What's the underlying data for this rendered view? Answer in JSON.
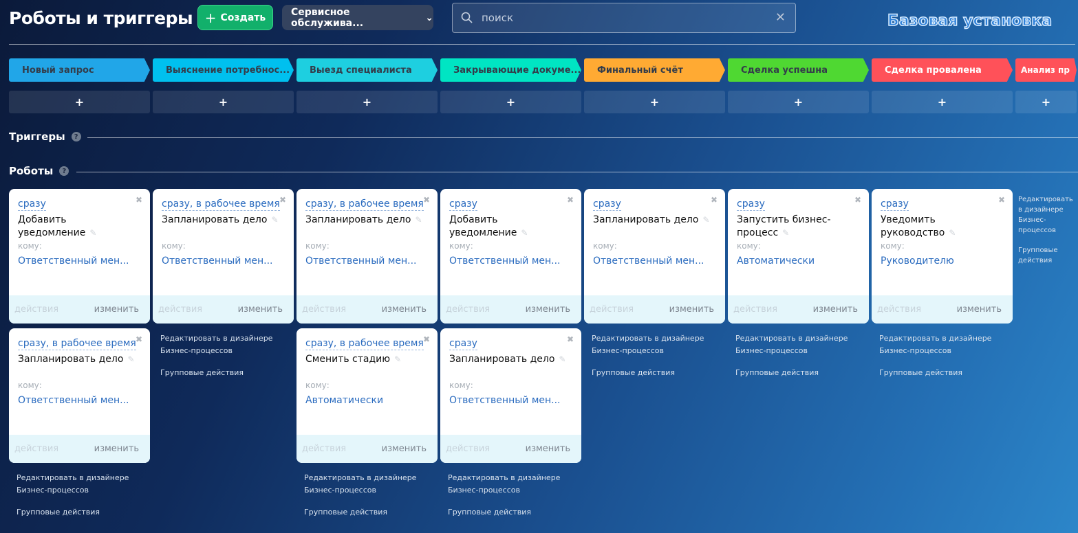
{
  "header": {
    "title": "Роботы и триггеры",
    "create_label": "Создать",
    "category": "Сервисное обслужива...",
    "search_placeholder": "поиск",
    "brand": "Базовая установка"
  },
  "stages": [
    {
      "label": "Новый запрос",
      "color": "#21a6e8",
      "text": "#333c4a"
    },
    {
      "label": "Выяснение потребнос...",
      "color": "#00c0ef",
      "text": "#333c4a"
    },
    {
      "label": "Выезд специалиста",
      "color": "#1ecfe0",
      "text": "#333c4a"
    },
    {
      "label": "Закрывающие докуме...",
      "color": "#00e5c3",
      "text": "#333c4a"
    },
    {
      "label": "Финальный счёт",
      "color": "#ffaa33",
      "text": "#333c4a"
    },
    {
      "label": "Сделка успешна",
      "color": "#4fd832",
      "text": "#333c4a"
    },
    {
      "label": "Сделка провалена",
      "color": "#ff5159",
      "text": "#ffffff"
    },
    {
      "label": "Анализ пр",
      "color": "#ff5159",
      "text": "#ffffff"
    }
  ],
  "add_label": "+",
  "sections": {
    "triggers": "Триггеры",
    "robots": "Роботы",
    "help": "?"
  },
  "card_labels": {
    "to": "кому:",
    "actions": "действия",
    "edit": "изменить"
  },
  "column_links": {
    "designer": "Редактировать в дизайнере Бизнес-процессов",
    "group": "Групповые действия"
  },
  "columns": [
    [
      {
        "when": "сразу",
        "name": "Добавить уведомление",
        "who": "Ответственный мен..."
      },
      {
        "when": "сразу, в рабочее время",
        "name": "Запланировать дело",
        "who": "Ответственный мен..."
      }
    ],
    [
      {
        "when": "сразу, в рабочее время",
        "name": "Запланировать дело",
        "who": "Ответственный мен..."
      }
    ],
    [
      {
        "when": "сразу, в рабочее время",
        "name": "Запланировать дело",
        "who": "Ответственный мен..."
      },
      {
        "when": "сразу, в рабочее время",
        "name": "Сменить стадию",
        "who": "Автоматически"
      }
    ],
    [
      {
        "when": "сразу",
        "name": "Добавить уведомление",
        "who": "Ответственный мен..."
      },
      {
        "when": "сразу",
        "name": "Запланировать дело",
        "who": "Ответственный мен..."
      }
    ],
    [
      {
        "when": "сразу",
        "name": "Запланировать дело",
        "who": "Ответственный мен..."
      }
    ],
    [
      {
        "when": "сразу",
        "name": "Запустить бизнес-процесс",
        "who": "Автоматически"
      }
    ],
    [
      {
        "when": "сразу",
        "name": "Уведомить руководство",
        "who": "Руководителю"
      }
    ],
    []
  ]
}
